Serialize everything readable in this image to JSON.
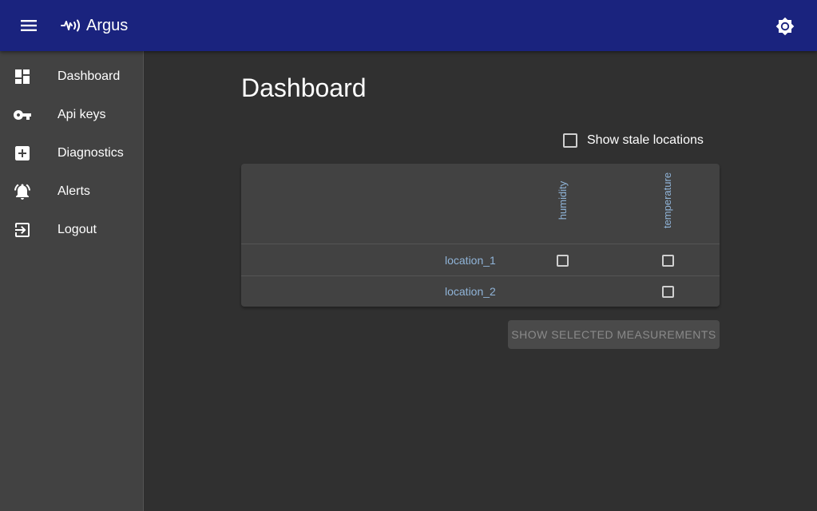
{
  "app": {
    "title": "Argus",
    "brand_color": "#1a237e",
    "logo_icon": "sensor-wave-icon",
    "menu_icon": "hamburger-menu-icon",
    "theme_icon": "brightness-icon"
  },
  "sidebar": {
    "items": [
      {
        "label": "Dashboard",
        "icon": "dashboard-icon"
      },
      {
        "label": "Api keys",
        "icon": "key-icon"
      },
      {
        "label": "Diagnostics",
        "icon": "medical-plus-icon"
      },
      {
        "label": "Alerts",
        "icon": "bell-alert-icon"
      },
      {
        "label": "Logout",
        "icon": "logout-icon"
      }
    ]
  },
  "main": {
    "title": "Dashboard",
    "stale_toggle": {
      "label": "Show stale locations",
      "checked": false
    },
    "table": {
      "columns": [
        "humidity",
        "temperature"
      ],
      "rows": [
        {
          "location": "location_1",
          "humidity": false,
          "temperature": false
        },
        {
          "location": "location_2",
          "temperature": false
        }
      ]
    },
    "show_button": {
      "label": "SHOW SELECTED MEASUREMENTS",
      "disabled": true
    }
  },
  "colors": {
    "background": "#303030",
    "sidebar": "#424242",
    "link": "#90b4d8"
  }
}
